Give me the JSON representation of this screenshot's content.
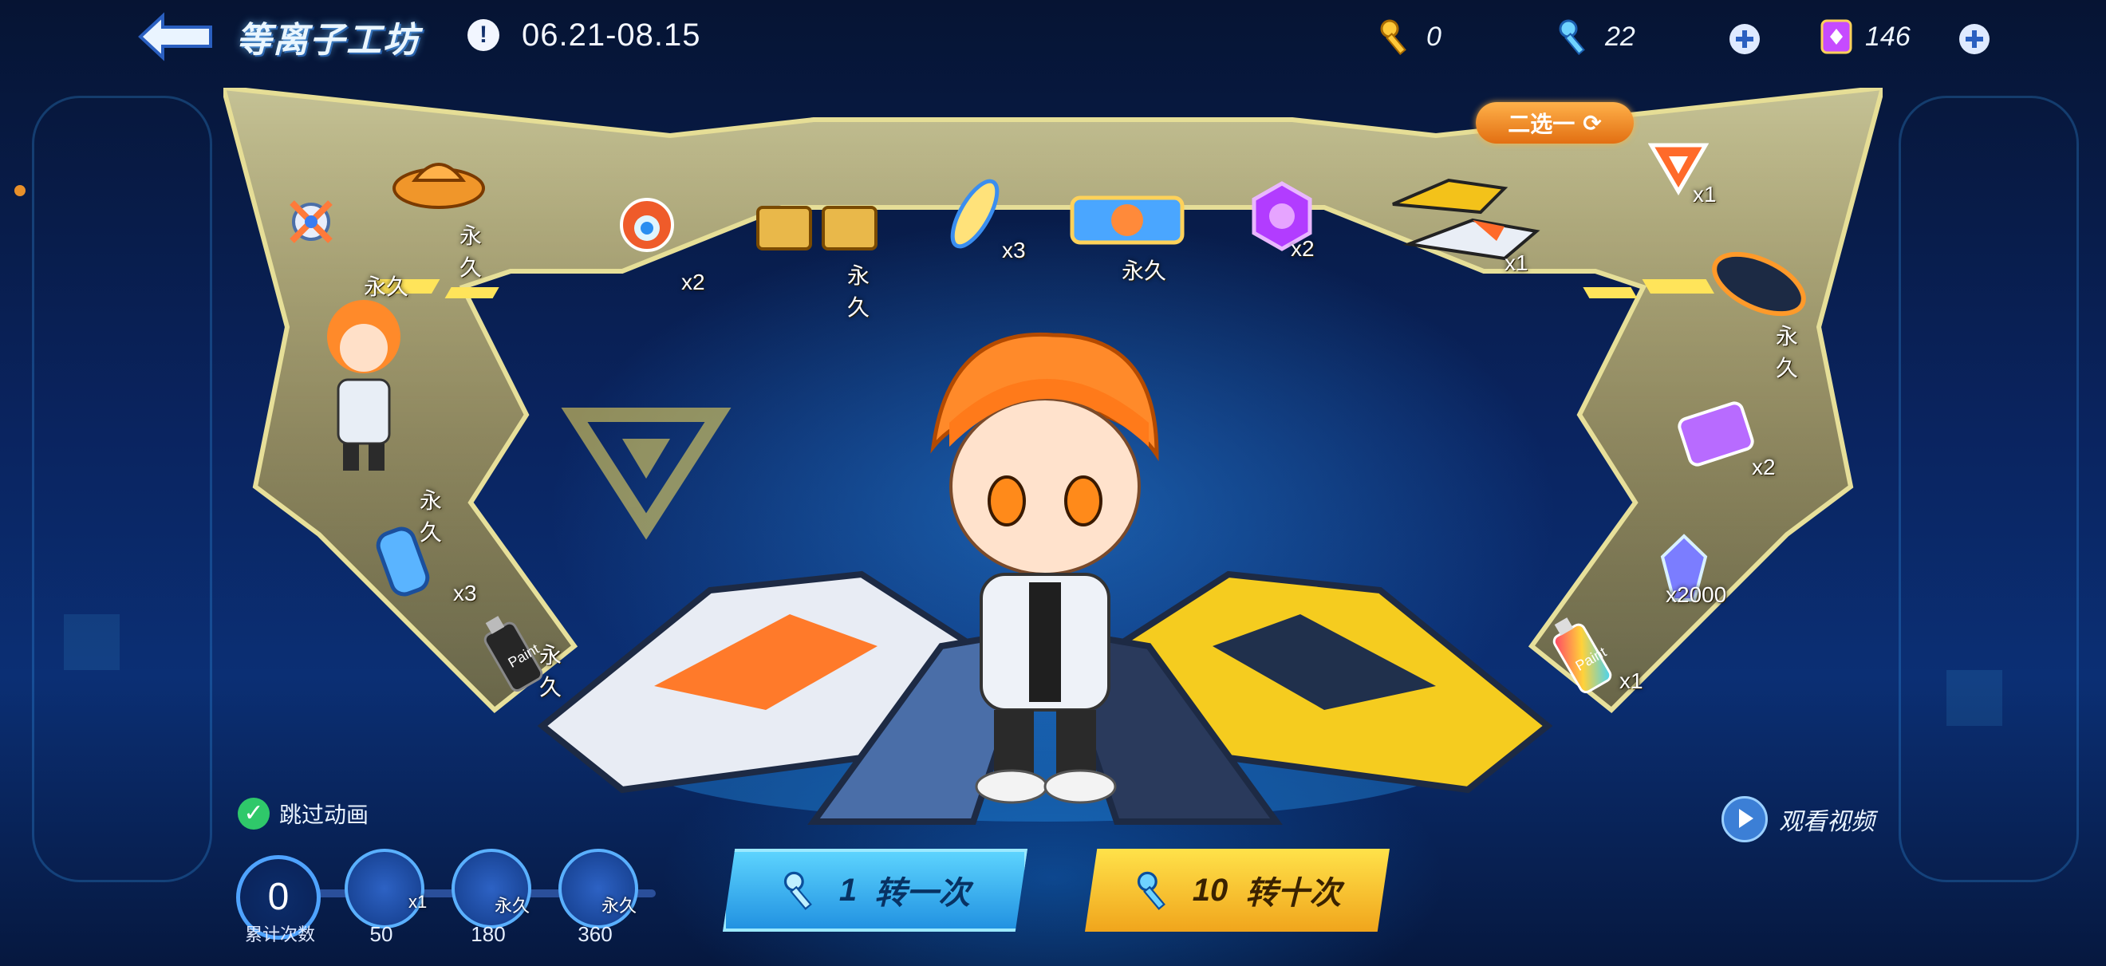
{
  "header": {
    "title": "等离子工坊",
    "info": "!",
    "dates": "06.21-08.15"
  },
  "currencies": [
    {
      "icon": "gold-key-icon",
      "value": "0"
    },
    {
      "icon": "blue-key-icon",
      "value": "22"
    },
    {
      "icon": "purple-ticket-icon",
      "value": "146"
    }
  ],
  "prizes": {
    "choose_one": "二选一",
    "items": [
      {
        "icon": "badge-icon",
        "label": ""
      },
      {
        "icon": "orange-helmet-icon",
        "label": "永久"
      },
      {
        "icon": "robot-pet-icon",
        "label": "x2"
      },
      {
        "icon": "gold-car-parts-icon",
        "label": "永久"
      },
      {
        "icon": "surfboard-icon",
        "label": "x3"
      },
      {
        "icon": "character-banner-icon",
        "label": "永久"
      },
      {
        "icon": "purple-coin-icon",
        "label": "x2"
      },
      {
        "icon": "race-cars-icon",
        "label": "x1"
      },
      {
        "icon": "emblem-icon",
        "label": "x1"
      },
      {
        "icon": "character-outfit-icon",
        "label": "永久"
      },
      {
        "icon": "character-item-icon",
        "label": "永久"
      },
      {
        "icon": "nitro-can-icon",
        "label": "x3"
      },
      {
        "icon": "black-paint-icon",
        "label": "永久"
      },
      {
        "icon": "hoverboard-icon",
        "label": "永久"
      },
      {
        "icon": "card-pack-icon",
        "label": "x2"
      },
      {
        "icon": "crystal-icon",
        "label": "x2000"
      },
      {
        "icon": "rainbow-paint-icon",
        "label": "x1"
      }
    ]
  },
  "paint_text": "Paint",
  "controls": {
    "skip_animation": "跳过动画",
    "counter_value": "0",
    "counter_label": "累计次数",
    "milestones": [
      {
        "count": "50",
        "tag": "x1",
        "icon": "gift-box-icon"
      },
      {
        "count": "180",
        "tag": "永久",
        "icon": "car-milestone-icon"
      },
      {
        "count": "360",
        "tag": "永久",
        "icon": "car-milestone-2-icon"
      }
    ],
    "spin_once": {
      "num": "1",
      "label": "转一次"
    },
    "spin_ten": {
      "num": "10",
      "label": "转十次"
    },
    "watch_video": "观看视频"
  }
}
